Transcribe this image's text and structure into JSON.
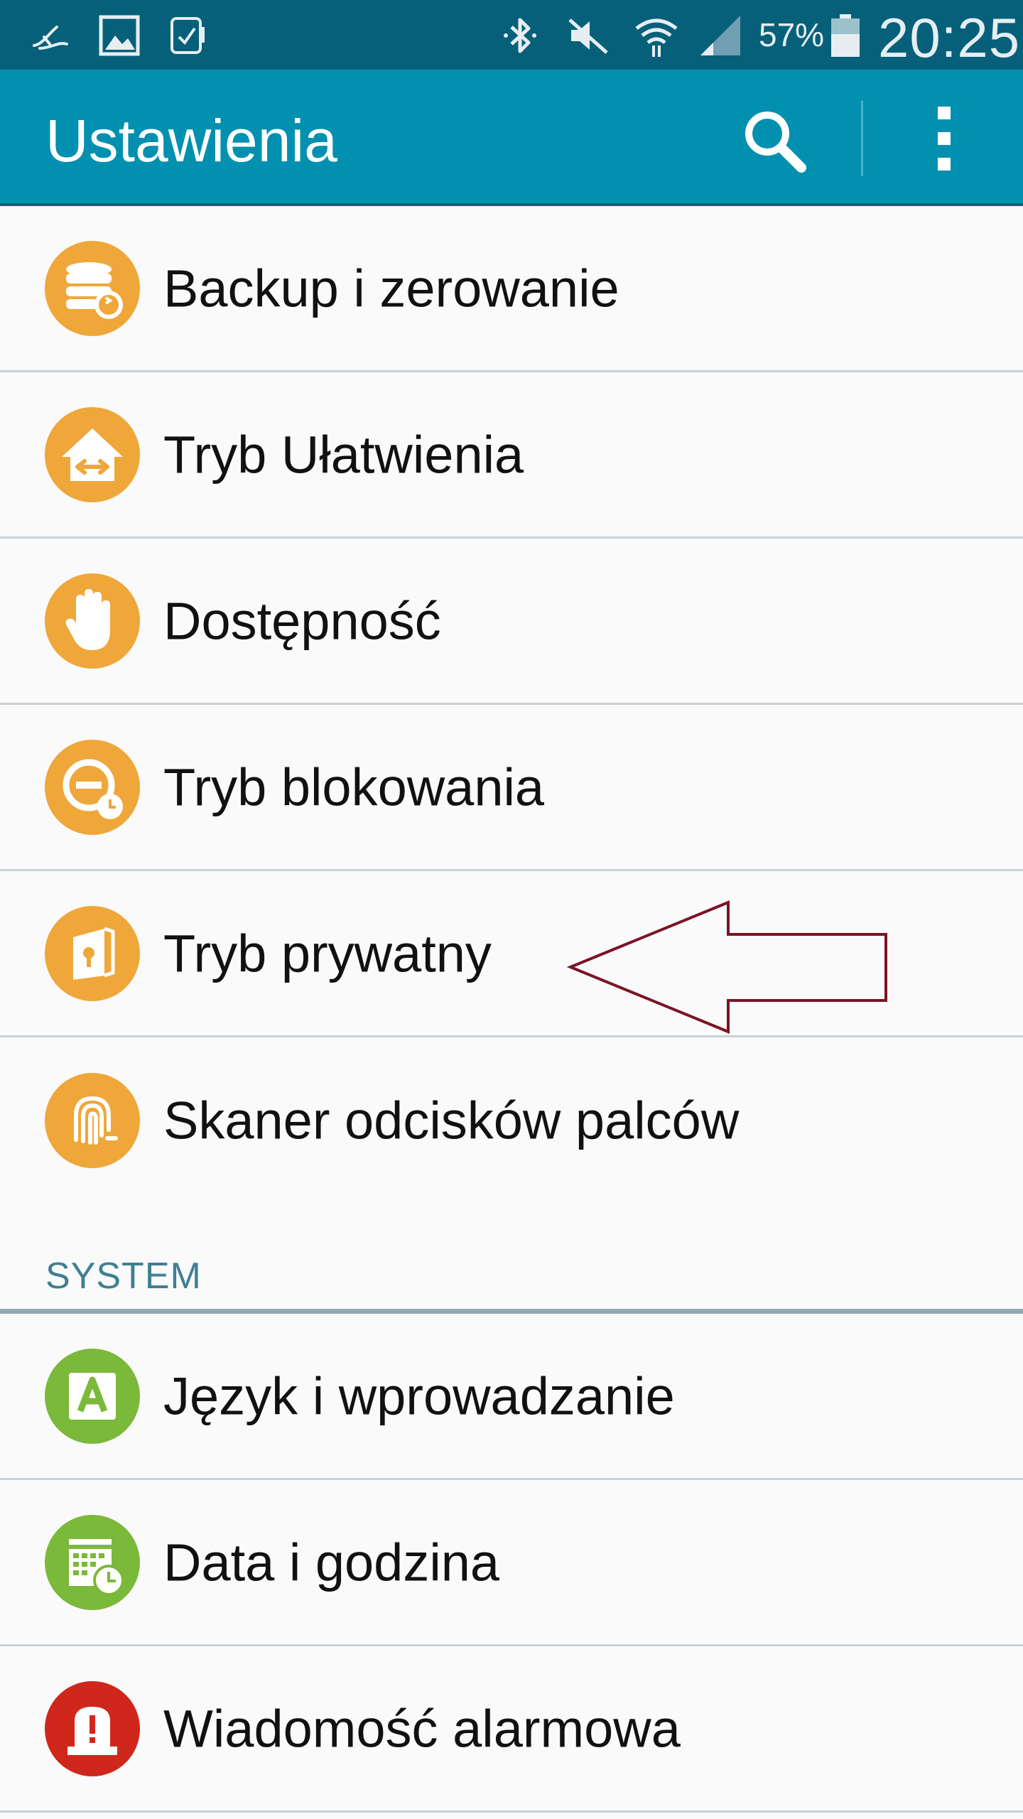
{
  "status_bar": {
    "battery_percent": "57%",
    "time": "20:25",
    "icons": [
      "notification-app-icon",
      "gallery-icon",
      "phone-card-icon",
      "bluetooth-icon",
      "mute-icon",
      "wifi-icon",
      "signal-icon",
      "battery-icon"
    ]
  },
  "app_bar": {
    "title": "Ustawienia",
    "search_icon": "search-icon",
    "menu_icon": "more-vertical-icon"
  },
  "items": [
    {
      "label": "Backup i zerowanie",
      "icon": "backup-database-icon",
      "color": "#efa73a"
    },
    {
      "label": "Tryb Ułatwienia",
      "icon": "easy-mode-house-icon",
      "color": "#efa73a"
    },
    {
      "label": "Dostępność",
      "icon": "hand-icon",
      "color": "#efa73a"
    },
    {
      "label": "Tryb blokowania",
      "icon": "blocking-mode-icon",
      "color": "#efa73a"
    },
    {
      "label": "Tryb prywatny",
      "icon": "private-mode-icon",
      "color": "#efa73a"
    },
    {
      "label": "Skaner odcisków palców",
      "icon": "fingerprint-icon",
      "color": "#efa73a"
    }
  ],
  "section": {
    "title": "SYSTEM"
  },
  "system_items": [
    {
      "label": "Język i wprowadzanie",
      "icon": "language-input-icon",
      "color": "#7bb93a"
    },
    {
      "label": "Data i godzina",
      "icon": "calendar-clock-icon",
      "color": "#7bb93a"
    },
    {
      "label": "Wiadomość alarmowa",
      "icon": "emergency-alarm-icon",
      "color": "#d0271c"
    }
  ],
  "annotation": {
    "color": "#7a1426"
  }
}
